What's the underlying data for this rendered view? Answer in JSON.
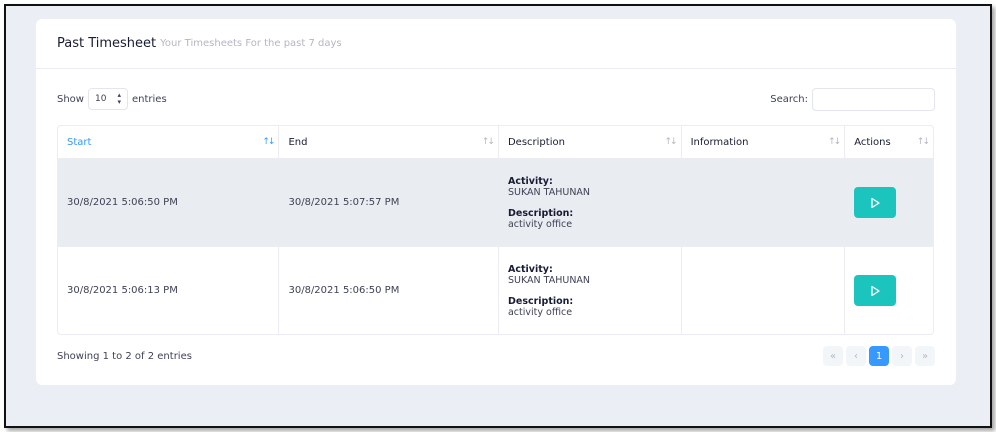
{
  "card": {
    "title": "Past Timesheet",
    "subtitle": "Your Timesheets For the past 7 days"
  },
  "length_control": {
    "show_label": "Show",
    "selected": "10",
    "entries_label": "entries"
  },
  "search": {
    "label": "Search:",
    "value": ""
  },
  "table": {
    "columns": [
      "Start",
      "End",
      "Description",
      "Information",
      "Actions"
    ],
    "sorted_column": "Start",
    "rows": [
      {
        "start": "30/8/2021 5:06:50 PM",
        "end": "30/8/2021 5:07:57 PM",
        "activity_label": "Activity:",
        "activity": "SUKAN TAHUNAN",
        "description_label": "Description:",
        "description": "activity office",
        "information": "",
        "action_icon": "play-icon"
      },
      {
        "start": "30/8/2021 5:06:13 PM",
        "end": "30/8/2021 5:06:50 PM",
        "activity_label": "Activity:",
        "activity": "SUKAN TAHUNAN",
        "description_label": "Description:",
        "description": "activity office",
        "information": "",
        "action_icon": "play-icon"
      }
    ]
  },
  "footer": {
    "info": "Showing 1 to 2 of 2 entries",
    "pagination": {
      "first": "«",
      "prev": "‹",
      "current": "1",
      "next": "›",
      "last": "»"
    }
  },
  "colors": {
    "accent": "#3699ff",
    "action_button": "#1bc5bd",
    "page_background": "#eceef6"
  }
}
